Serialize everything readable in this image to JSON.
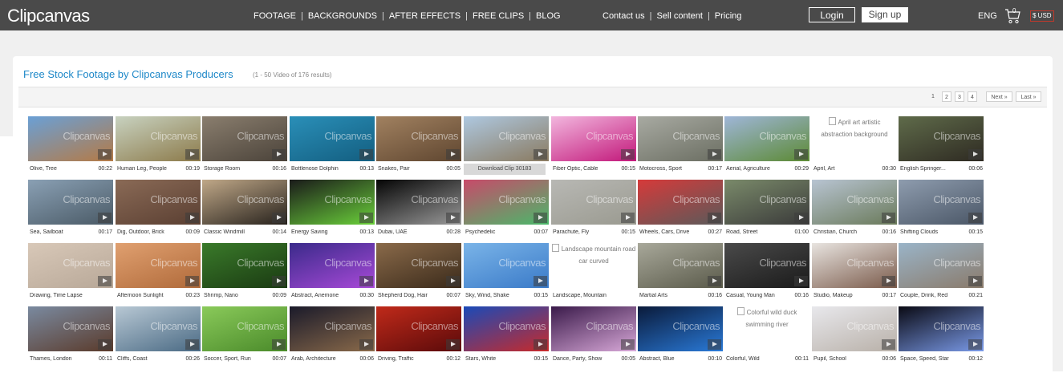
{
  "header": {
    "logo": "Clipcanvas",
    "nav_main": [
      "FOOTAGE",
      "BACKGROUNDS",
      "AFTER EFFECTS",
      "FREE CLIPS",
      "BLOG"
    ],
    "nav_right": [
      "Contact us",
      "Sell content",
      "Pricing"
    ],
    "login_label": "Login",
    "signup_label": "Sign up",
    "language": "ENG",
    "cart_count": "0",
    "currency": "$ USD"
  },
  "listing": {
    "title": "Free Stock Footage by Clipcanvas Producers",
    "result_info": "(1 - 50  Video of 176 results)",
    "pages": [
      "1",
      "2",
      "3",
      "4"
    ],
    "next_label": "Next »",
    "last_label": "Last »",
    "watermark": "Clipcanvas"
  },
  "clips": [
    {
      "label": "Olive, Tree",
      "duration": "00:22",
      "colors": [
        "#6aa0d6",
        "#b57a45"
      ]
    },
    {
      "label": "Human Leg, People",
      "duration": "00:19",
      "colors": [
        "#c8d2c0",
        "#8c7a4a"
      ]
    },
    {
      "label": "Storage Room",
      "duration": "00:16",
      "colors": [
        "#8a7e6e",
        "#4b433a"
      ]
    },
    {
      "label": "Bottlenose Dolphin",
      "duration": "00:13",
      "colors": [
        "#2a8fb8",
        "#135e80"
      ]
    },
    {
      "label": "Snakes, Pair",
      "duration": "00:05",
      "colors": [
        "#a18160",
        "#5f4630"
      ]
    },
    {
      "label": "",
      "duration": "",
      "download": "Download Clip 30183",
      "colors": [
        "#aec8e0",
        "#8a7a60"
      ]
    },
    {
      "label": "Fiber Optic, Cable",
      "duration": "00:15",
      "colors": [
        "#f2b6de",
        "#c2187a"
      ]
    },
    {
      "label": "Motocross, Sport",
      "duration": "00:17",
      "colors": [
        "#a8aaa2",
        "#6b6e62"
      ]
    },
    {
      "label": "Aerial, Agriculture",
      "duration": "00:29",
      "colors": [
        "#9fb6d8",
        "#5c8a34"
      ]
    },
    {
      "label": "April, Art",
      "duration": "00:30",
      "broken": "April art artistic abstraction background"
    },
    {
      "label": "English Springer...",
      "duration": "00:06",
      "colors": [
        "#5f6b4a",
        "#2e2a22"
      ]
    },
    {
      "label": "Sea, Sailboat",
      "duration": "00:17",
      "colors": [
        "#8aa0b4",
        "#4a5a66"
      ]
    },
    {
      "label": "Dig, Outdoor, Brick",
      "duration": "00:09",
      "colors": [
        "#8a6a56",
        "#5a3f32"
      ]
    },
    {
      "label": "Classic Windmill",
      "duration": "00:14",
      "colors": [
        "#c0a888",
        "#26211c"
      ]
    },
    {
      "label": "Energy Saving",
      "duration": "00:13",
      "colors": [
        "#1a1a1a",
        "#6ad03a"
      ]
    },
    {
      "label": "Dubai, UAE",
      "duration": "00:28",
      "colors": [
        "#050505",
        "#9a9a9a"
      ]
    },
    {
      "label": "Psychedelic",
      "duration": "00:07",
      "colors": [
        "#c84a6a",
        "#4ab86a"
      ]
    },
    {
      "label": "Parachute, Fly",
      "duration": "00:15",
      "colors": [
        "#b8b8b4",
        "#9a9a90"
      ]
    },
    {
      "label": "Wheels, Cars, Drive",
      "duration": "00:27",
      "colors": [
        "#d63a3a",
        "#5a5a5a"
      ]
    },
    {
      "label": "Road, Street",
      "duration": "01:00",
      "colors": [
        "#7a8a6a",
        "#3a3a3a"
      ]
    },
    {
      "label": "Christian, Church",
      "duration": "00:16",
      "colors": [
        "#b8c4d2",
        "#6a7a5a"
      ]
    },
    {
      "label": "Shifting Clouds",
      "duration": "00:15",
      "colors": [
        "#8e9cae",
        "#4a5666"
      ]
    },
    {
      "label": "Drawing, Time Lapse",
      "duration": "",
      "colors": [
        "#d8c8b8",
        "#b8a898"
      ]
    },
    {
      "label": "Afternoon Sunlight",
      "duration": "00:23",
      "colors": [
        "#e0a070",
        "#b06a3a"
      ]
    },
    {
      "label": "Shrimp, Nano",
      "duration": "00:09",
      "colors": [
        "#3a7a2a",
        "#1a3a12"
      ]
    },
    {
      "label": "Abstract, Anemone",
      "duration": "00:30",
      "colors": [
        "#3a2a8a",
        "#a84ad8"
      ]
    },
    {
      "label": "Shepherd Dog, Hair",
      "duration": "00:07",
      "colors": [
        "#8a6a4a",
        "#3a2a1a"
      ]
    },
    {
      "label": "Sky, Wind, Shake",
      "duration": "00:15",
      "colors": [
        "#7ab4e8",
        "#3a7ac8"
      ]
    },
    {
      "label": "Landscape, Mountain",
      "duration": "",
      "broken": "Landscape mountain road car curved"
    },
    {
      "label": "Martial Arts",
      "duration": "00:16",
      "colors": [
        "#a8a89a",
        "#5a5a4a"
      ]
    },
    {
      "label": "Casual, Young Man",
      "duration": "00:16",
      "colors": [
        "#4a4a4a",
        "#1a1a1a"
      ]
    },
    {
      "label": "Studio, Makeup",
      "duration": "00:17",
      "colors": [
        "#e8e4e0",
        "#7a5a4a"
      ]
    },
    {
      "label": "Couple, Drink, Red",
      "duration": "00:21",
      "colors": [
        "#9ab4c8",
        "#8a7a6a"
      ]
    },
    {
      "label": "Thames, London",
      "duration": "00:11",
      "colors": [
        "#7a8aa0",
        "#5a3a2a"
      ]
    },
    {
      "label": "Cliffs, Coast",
      "duration": "00:26",
      "colors": [
        "#b8c8d4",
        "#4a6a84"
      ]
    },
    {
      "label": "Soccer, Sport, Run",
      "duration": "00:07",
      "colors": [
        "#8aca5a",
        "#4a8a2a"
      ]
    },
    {
      "label": "Arab, Architecture",
      "duration": "00:06",
      "colors": [
        "#1a1a2a",
        "#8a6a4a"
      ]
    },
    {
      "label": "Driving, Traffic",
      "duration": "00:12",
      "colors": [
        "#c02a1a",
        "#5a0a0a"
      ]
    },
    {
      "label": "Stars, White",
      "duration": "00:15",
      "colors": [
        "#1a4ab8",
        "#c82a2a"
      ]
    },
    {
      "label": "Dance, Party, Show",
      "duration": "00:05",
      "colors": [
        "#3a1a4a",
        "#d8a8d8"
      ]
    },
    {
      "label": "Abstract, Blue",
      "duration": "00:10",
      "colors": [
        "#0a1a3a",
        "#2a7ad8"
      ]
    },
    {
      "label": "Colorful, Wild",
      "duration": "00:11",
      "broken": "Colorful wild duck swimming river"
    },
    {
      "label": "Pupil, School",
      "duration": "00:06",
      "colors": [
        "#e8e8ec",
        "#b8b0a8"
      ]
    },
    {
      "label": "Space, Speed, Star",
      "duration": "00:12",
      "colors": [
        "#0a0a14",
        "#7a9ae8"
      ]
    }
  ]
}
